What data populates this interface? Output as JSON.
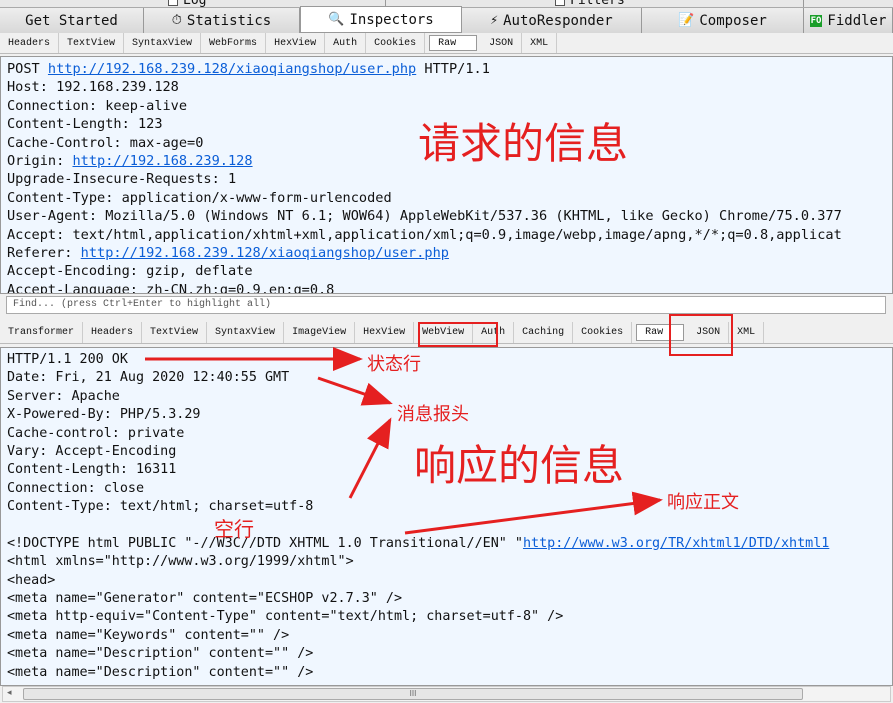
{
  "top_strip": [
    "Log",
    "Filters"
  ],
  "tabs": [
    {
      "label": "Get Started",
      "icon": ""
    },
    {
      "label": "Statistics",
      "icon": "stopwatch-icon"
    },
    {
      "label": "Inspectors",
      "icon": "magnifier-icon",
      "active": true
    },
    {
      "label": "AutoResponder",
      "icon": "lightning-icon"
    },
    {
      "label": "Composer",
      "icon": "pencil-icon"
    },
    {
      "label": "Fiddler",
      "icon": "fo-icon"
    }
  ],
  "request_tabs": [
    "Headers",
    "TextView",
    "SyntaxView",
    "WebForms",
    "HexView",
    "Auth",
    "Cookies",
    "Raw",
    "JSON",
    "XML"
  ],
  "request_selected": "Raw",
  "request_lines": [
    [
      "POST ",
      "http://192.168.239.128/xiaoqiangshop/user.php",
      " HTTP/1.1"
    ],
    [
      "Host: 192.168.239.128"
    ],
    [
      "Connection: keep-alive"
    ],
    [
      "Content-Length: 123"
    ],
    [
      "Cache-Control: max-age=0"
    ],
    [
      "Origin: ",
      "http://192.168.239.128"
    ],
    [
      "Upgrade-Insecure-Requests: 1"
    ],
    [
      "Content-Type: application/x-www-form-urlencoded"
    ],
    [
      "User-Agent: Mozilla/5.0 (Windows NT 6.1; WOW64) AppleWebKit/537.36 (KHTML, like Gecko) Chrome/75.0.377"
    ],
    [
      "Accept: text/html,application/xhtml+xml,application/xml;q=0.9,image/webp,image/apng,*/*;q=0.8,applicat"
    ],
    [
      "Referer: ",
      "http://192.168.239.128/xiaoqiangshop/user.php"
    ],
    [
      "Accept-Encoding: gzip, deflate"
    ],
    [
      "Accept-Language: zh-CN,zh;q=0.9,en;q=0.8"
    ]
  ],
  "find_placeholder": "Find... (press Ctrl+Enter to highlight all)",
  "response_tabs": [
    "Transformer",
    "Headers",
    "TextView",
    "SyntaxView",
    "ImageView",
    "HexView",
    "WebView",
    "Auth",
    "Caching",
    "Cookies",
    "Raw",
    "JSON",
    "XML"
  ],
  "response_selected": "Raw",
  "response_lines": [
    [
      "HTTP/1.1 200 OK"
    ],
    [
      "Date: Fri, 21 Aug 2020 12:40:55 GMT"
    ],
    [
      "Server: Apache"
    ],
    [
      "X-Powered-By: PHP/5.3.29"
    ],
    [
      "Cache-control: private"
    ],
    [
      "Vary: Accept-Encoding"
    ],
    [
      "Content-Length: 16311"
    ],
    [
      "Connection: close"
    ],
    [
      "Content-Type: text/html; charset=utf-8"
    ],
    [
      ""
    ],
    [
      "<!DOCTYPE html PUBLIC \"-//W3C//DTD XHTML 1.0 Transitional//EN\" \"",
      "http://www.w3.org/TR/xhtml1/DTD/xhtml1"
    ],
    [
      "<html xmlns=\"http://www.w3.org/1999/xhtml\">"
    ],
    [
      "<head>"
    ],
    [
      "<meta name=\"Generator\" content=\"ECSHOP v2.7.3\" />"
    ],
    [
      "<meta http-equiv=\"Content-Type\" content=\"text/html; charset=utf-8\" />"
    ],
    [
      "<meta name=\"Keywords\" content=\"\" />"
    ],
    [
      "<meta name=\"Description\" content=\"\" />"
    ],
    [
      "<meta name=\"Description\" content=\"\" />"
    ]
  ],
  "annotations": {
    "request_info": "请求的信息",
    "response_info": "响应的信息",
    "status_line": "状态行",
    "headers": "消息报头",
    "blank_line": "空行",
    "body": "响应正文"
  },
  "annotation_color": "#e52020",
  "scrollbar_grip": "III"
}
